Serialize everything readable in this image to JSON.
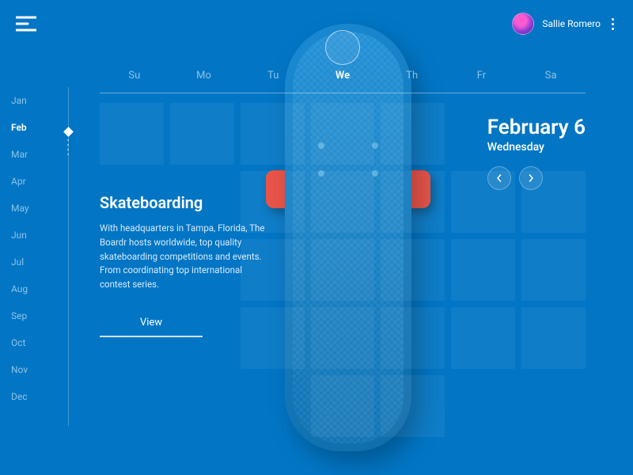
{
  "user": {
    "name": "Sallie Romero"
  },
  "months": [
    "Jan",
    "Feb",
    "Mar",
    "Apr",
    "May",
    "Jun",
    "Jul",
    "Aug",
    "Sep",
    "Oct",
    "Nov",
    "Dec"
  ],
  "active_month_index": 1,
  "days": [
    "Su",
    "Mo",
    "Tu",
    "We",
    "Th",
    "Fr",
    "Sa"
  ],
  "active_day_index": 3,
  "selected_date": {
    "title": "February 6",
    "weekday": "Wednesday"
  },
  "event": {
    "title": "Skateboarding",
    "body": "With headquarters in Tampa, Florida, The Boardr hosts worldwide, top quality skateboarding competitions and events. From coordinating top international contest series.",
    "cta": "View"
  }
}
